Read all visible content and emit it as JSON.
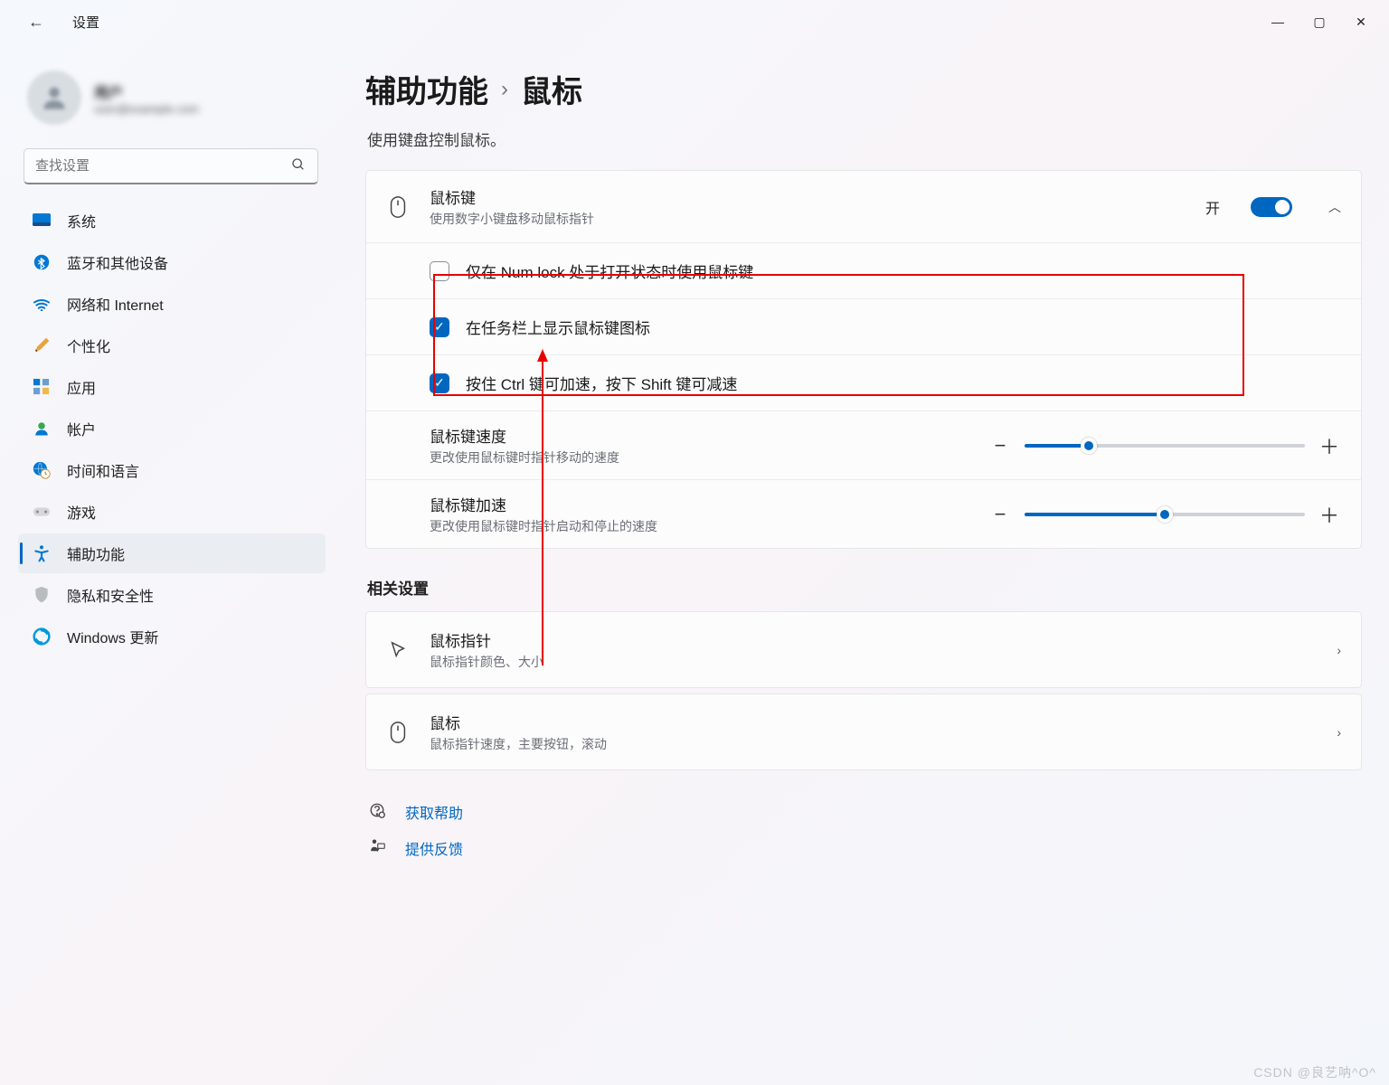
{
  "window": {
    "title": "设置"
  },
  "profile": {
    "name": "用户",
    "email": "user@example.com"
  },
  "search": {
    "placeholder": "查找设置"
  },
  "nav": {
    "items": [
      {
        "label": "系统"
      },
      {
        "label": "蓝牙和其他设备"
      },
      {
        "label": "网络和 Internet"
      },
      {
        "label": "个性化"
      },
      {
        "label": "应用"
      },
      {
        "label": "帐户"
      },
      {
        "label": "时间和语言"
      },
      {
        "label": "游戏"
      },
      {
        "label": "辅助功能"
      },
      {
        "label": "隐私和安全性"
      },
      {
        "label": "Windows 更新"
      }
    ]
  },
  "breadcrumb": {
    "parent": "辅助功能",
    "current": "鼠标"
  },
  "page": {
    "subtitle": "使用键盘控制鼠标。"
  },
  "mouseKeys": {
    "title": "鼠标键",
    "desc": "使用数字小键盘移动鼠标指针",
    "toggleLabel": "开",
    "row1": "仅在 Num lock 处于打开状态时使用鼠标键",
    "row2": "在任务栏上显示鼠标键图标",
    "row3": "按住 Ctrl 键可加速，按下 Shift 键可减速",
    "slider1": {
      "title": "鼠标键速度",
      "desc": "更改使用鼠标键时指针移动的速度",
      "value": 23
    },
    "slider2": {
      "title": "鼠标键加速",
      "desc": "更改使用鼠标键时指针启动和停止的速度",
      "value": 50
    }
  },
  "related": {
    "title": "相关设置",
    "items": [
      {
        "title": "鼠标指针",
        "desc": "鼠标指针颜色、大小"
      },
      {
        "title": "鼠标",
        "desc": "鼠标指针速度，主要按钮，滚动"
      }
    ]
  },
  "help": {
    "getHelp": "获取帮助",
    "feedback": "提供反馈"
  },
  "watermark": "CSDN @良艺呐^O^"
}
